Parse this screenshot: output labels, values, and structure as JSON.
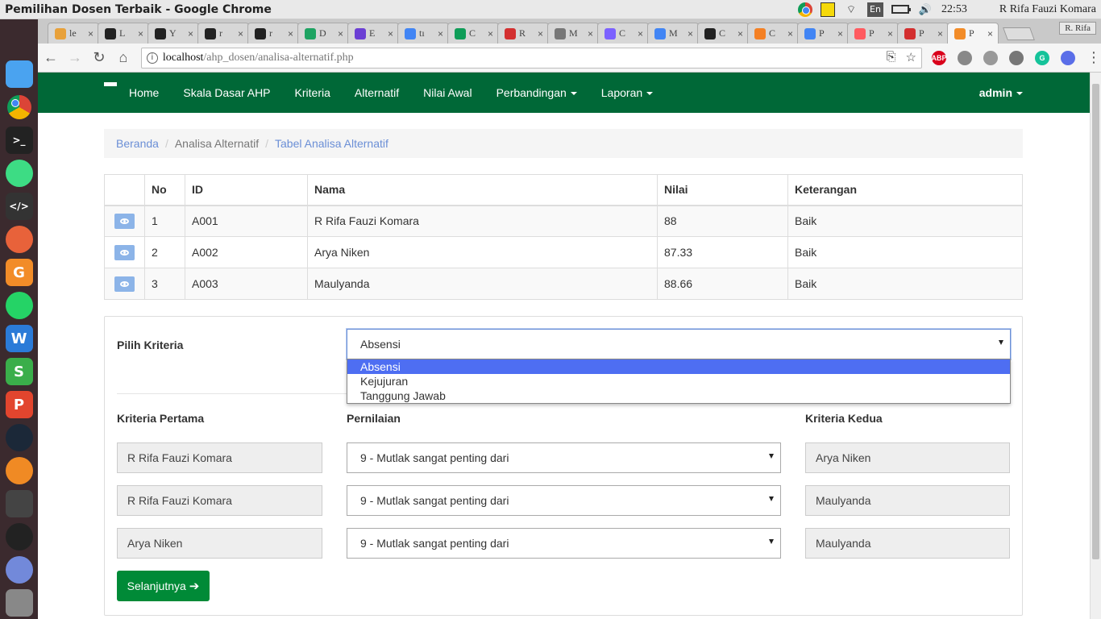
{
  "os": {
    "window_title": "Pemilihan Dosen Terbaik - Google Chrome",
    "lang": "En",
    "time": "22:53",
    "user": "R Rifa Fauzi Komara"
  },
  "browser": {
    "tabs": [
      {
        "label": "le",
        "color": "#e8a13a"
      },
      {
        "label": "L",
        "color": "#222222"
      },
      {
        "label": "Y",
        "color": "#222222"
      },
      {
        "label": "r",
        "color": "#222222"
      },
      {
        "label": "r",
        "color": "#222222"
      },
      {
        "label": "D",
        "color": "#1ea362"
      },
      {
        "label": "E",
        "color": "#6b3fd4"
      },
      {
        "label": "tı",
        "color": "#4285f4"
      },
      {
        "label": "C",
        "color": "#0f9d58"
      },
      {
        "label": "R",
        "color": "#d32f2f"
      },
      {
        "label": "M",
        "color": "#777777"
      },
      {
        "label": "C",
        "color": "#7b61ff"
      },
      {
        "label": "M",
        "color": "#4285f4"
      },
      {
        "label": "C",
        "color": "#222222"
      },
      {
        "label": "C",
        "color": "#f48024"
      },
      {
        "label": "P",
        "color": "#4285f4"
      },
      {
        "label": "P",
        "color": "#ff5a5f"
      },
      {
        "label": "P",
        "color": "#d32f2f"
      },
      {
        "label": "P",
        "color": "#f28c28"
      }
    ],
    "profile_name": "R. Rifa",
    "url_host": "localhost",
    "url_path": "/ahp_dosen/analisa-alternatif.php",
    "extensions": [
      {
        "name": "ABP",
        "color": "#d9001b"
      },
      {
        "name": "",
        "color": "#888888"
      },
      {
        "name": "",
        "color": "#999999"
      },
      {
        "name": "",
        "color": "#777777"
      },
      {
        "name": "G",
        "color": "#15c39a"
      },
      {
        "name": "",
        "color": "#5a6ee8"
      }
    ]
  },
  "navbar": {
    "color": "#006837",
    "links": [
      {
        "label": "Home",
        "dropdown": false
      },
      {
        "label": "Skala Dasar AHP",
        "dropdown": false
      },
      {
        "label": "Kriteria",
        "dropdown": false
      },
      {
        "label": "Alternatif",
        "dropdown": false
      },
      {
        "label": "Nilai Awal",
        "dropdown": false
      },
      {
        "label": "Perbandingan",
        "dropdown": true
      },
      {
        "label": "Laporan",
        "dropdown": true
      }
    ],
    "user": "admin"
  },
  "breadcrumb": {
    "home": "Beranda",
    "middle": "Analisa Alternatif",
    "current": "Tabel Analisa Alternatif"
  },
  "table": {
    "headers": [
      "",
      "No",
      "ID",
      "Nama",
      "Nilai",
      "Keterangan"
    ],
    "rows": [
      {
        "no": "1",
        "id": "A001",
        "nama": "R Rifa Fauzi Komara",
        "nilai": "88",
        "keterangan": "Baik"
      },
      {
        "no": "2",
        "id": "A002",
        "nama": "Arya Niken",
        "nilai": "87.33",
        "keterangan": "Baik"
      },
      {
        "no": "3",
        "id": "A003",
        "nama": "Maulyanda",
        "nilai": "88.66",
        "keterangan": "Baik"
      }
    ]
  },
  "form": {
    "pilih_label": "Pilih Kriteria",
    "pilih_value": "Absensi",
    "options": [
      "Absensi",
      "Kejujuran",
      "Tanggung Jawab"
    ],
    "col_first": "Kriteria Pertama",
    "col_rating": "Pernilaian",
    "col_second": "Kriteria Kedua",
    "comparisons": [
      {
        "first": "R Rifa Fauzi Komara",
        "rating": "9 - Mutlak sangat penting dari",
        "second": "Arya Niken"
      },
      {
        "first": "R Rifa Fauzi Komara",
        "rating": "9 - Mutlak sangat penting dari",
        "second": "Maulyanda"
      },
      {
        "first": "Arya Niken",
        "rating": "9 - Mutlak sangat penting dari",
        "second": "Maulyanda"
      }
    ],
    "next_button": "Selanjutnya"
  }
}
